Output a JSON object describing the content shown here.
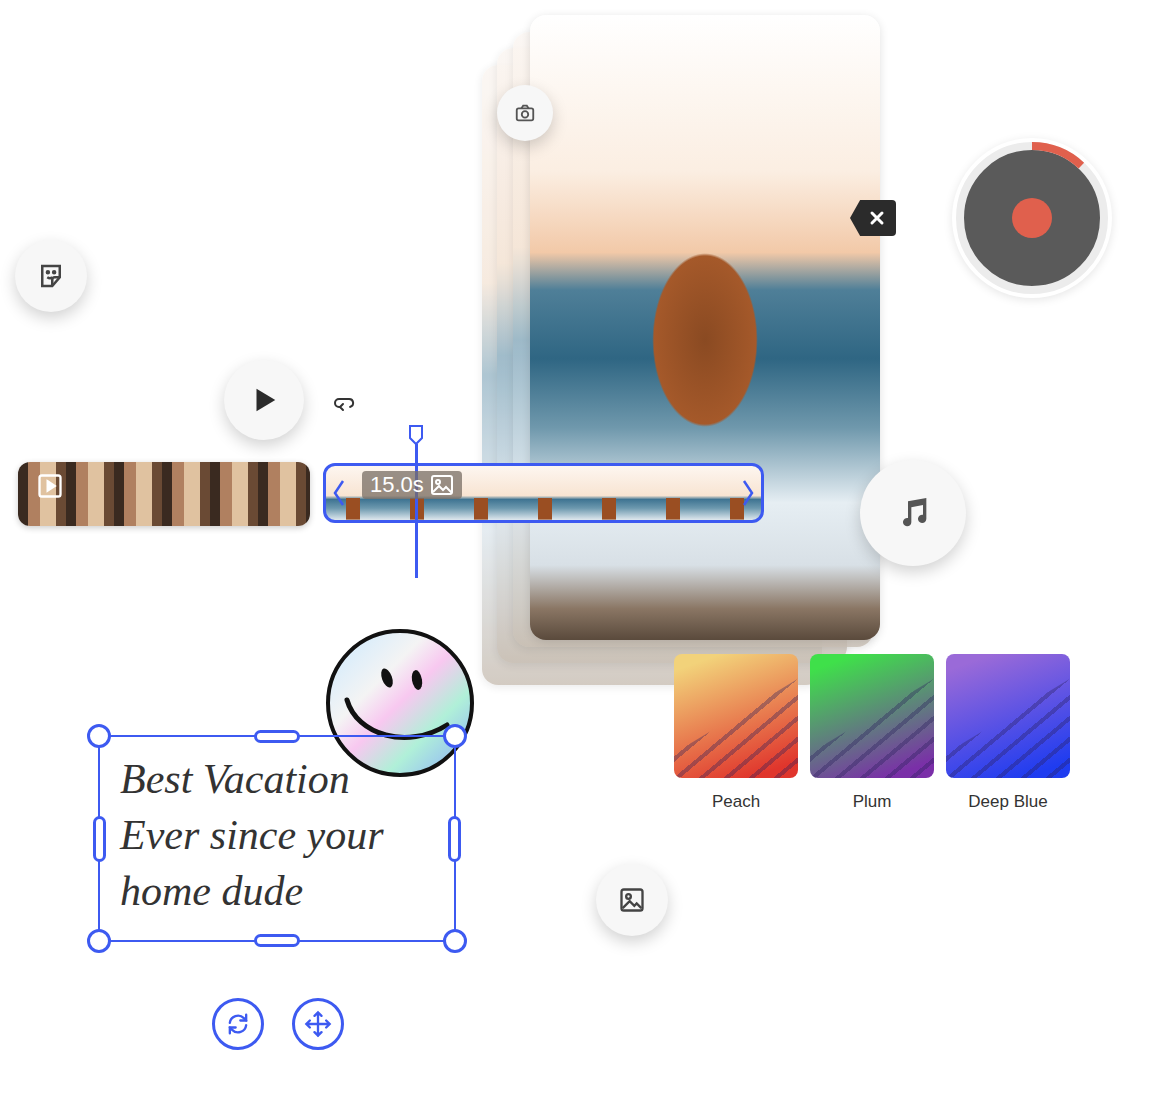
{
  "timeline": {
    "clips": [
      {
        "kind": "video",
        "selected": false
      },
      {
        "kind": "image",
        "selected": true,
        "duration": "15.0s"
      }
    ]
  },
  "text_box": {
    "lines": [
      "Best Vacation",
      "Ever since your",
      "home dude"
    ],
    "selected": true
  },
  "record": {
    "level": 0.12
  },
  "filters": [
    {
      "label": "Peach",
      "selected": false,
      "colors": [
        "#f2d27a",
        "#e0352c"
      ]
    },
    {
      "label": "Plum",
      "selected": false,
      "colors": [
        "#3fe04a",
        "#7a2fa8"
      ]
    },
    {
      "label": "Deep Blue",
      "selected": false,
      "colors": [
        "#9a6ad8",
        "#1f3cf0"
      ]
    }
  ]
}
